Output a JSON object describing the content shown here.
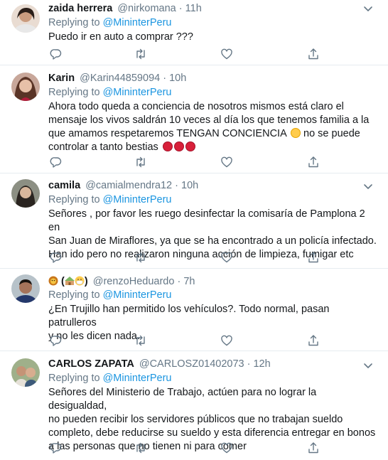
{
  "tweets": [
    {
      "name": "zaida herrera",
      "handle": "@nirkomana",
      "dot": "·",
      "time": "11h",
      "replying_prefix": "Replying to ",
      "mention": "@MininterPeru",
      "lines": [
        "Puedo ir en auto a comprar ???"
      ]
    },
    {
      "name": "Karin",
      "handle": "@Karin44859094",
      "dot": "·",
      "time": "10h",
      "replying_prefix": "Replying to ",
      "mention": "@MininterPeru",
      "lines": [
        "Ahora todo queda a conciencia de nosotros mismos está claro el",
        "mensaje los vivos saldrán 10 veces al día los que tenemos familia a la",
        "que amamos respetaremos TENGAN CONCIENCIA",
        "no se puede",
        "controlar a tanto bestias"
      ]
    },
    {
      "name": "camila",
      "handle": "@camialmendra12",
      "dot": "·",
      "time": "10h",
      "replying_prefix": "Replying to ",
      "mention": "@MininterPeru",
      "lines": [
        "Señores , por favor les ruego desinfectar la comisaría de Pamplona 2 en",
        "San Juan de Miraflores, ya que se ha encontrado a un policía infectado.",
        "Han ido pero no realizaron ninguna acción de limpieza, fumigar etc"
      ]
    },
    {
      "name_open": "(",
      "name_close": ")",
      "handle": "@renzoHeduardo",
      "dot": "·",
      "time": "7h",
      "replying_prefix": "Replying to ",
      "mention": "@MininterPeru",
      "lines": [
        "¿En Trujillo han permitido los vehículos?. Todo normal, pasan patrulleros",
        "y no les dicen nada."
      ]
    },
    {
      "name": "CARLOS ZAPATA",
      "handle": "@CARLOSZ01402073",
      "dot": "·",
      "time": "12h",
      "replying_prefix": "Replying to ",
      "mention": "@MininterPeru",
      "lines": [
        "Señores del Ministerio de Trabajo, actúen para no lograr la desigualdad,",
        "no pueden recibir los servidores públicos que no trabajan sueldo",
        "completo, debe reducirse su sueldo y esta diferencia entregar en bonos",
        "a las personas que no tienen ni para comer"
      ]
    }
  ],
  "colors": {
    "text": "#14171a",
    "secondary": "#657786",
    "link": "#1b95e0",
    "divider": "#e6ecf0"
  },
  "icons": [
    "reply-icon",
    "retweet-icon",
    "like-icon",
    "share-icon",
    "chevron-down-icon"
  ]
}
